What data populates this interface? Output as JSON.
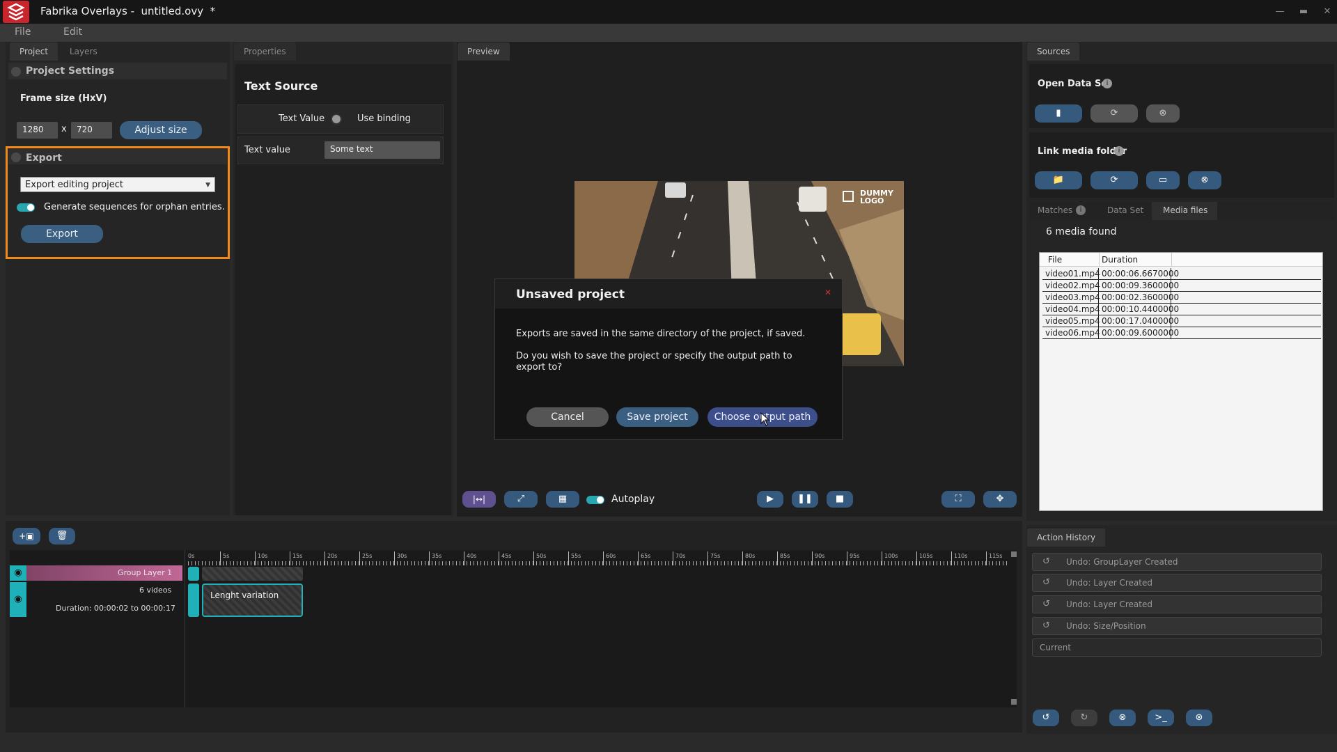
{
  "window": {
    "app_name": "Fabrika Overlays -  untitled.ovy  *",
    "minimize_icon": "minimize-icon",
    "maximize_icon": "maximize-icon",
    "close_icon": "close-icon"
  },
  "menu": {
    "file": "File",
    "edit": "Edit"
  },
  "left_panel": {
    "tabs": [
      "Project",
      "Layers"
    ],
    "project_settings": "Project Settings",
    "frame_size_label": "Frame size (HxV)",
    "width": "1280",
    "height": "720",
    "x_sep": "x",
    "adjust_size": "Adjust size",
    "export_section": "Export",
    "export_mode": "Export editing project",
    "orphan_label": "Generate sequences for orphan entries.",
    "export_button": "Export"
  },
  "properties_panel": {
    "tab": "Properties",
    "title": "Text Source",
    "text_value_label": "Text Value",
    "use_binding": "Use binding",
    "text_value_row_label": "Text value",
    "text_value": "Some text"
  },
  "preview_panel": {
    "tab": "Preview",
    "logo_text_1": "DUMMY",
    "logo_text_2": "LOGO",
    "autoplay": "Autoplay"
  },
  "sources_panel": {
    "tab": "Sources",
    "open_data_set": "Open Data Set",
    "link_media_folder": "Link media folder",
    "subtabs": [
      "Matches",
      "Data Set",
      "Media files"
    ],
    "media_found": "6 media found",
    "table": {
      "headers": [
        "File",
        "Duration"
      ],
      "rows": [
        [
          "video01.mp4",
          "00:00:06.6670000"
        ],
        [
          "video02.mp4",
          "00:00:09.3600000"
        ],
        [
          "video03.mp4",
          "00:00:02.3600000"
        ],
        [
          "video04.mp4",
          "00:00:10.4400000"
        ],
        [
          "video05.mp4",
          "00:00:17.0400000"
        ],
        [
          "video06.mp4",
          "00:00:09.6000000"
        ]
      ]
    }
  },
  "history_panel": {
    "tab": "Action History",
    "items": [
      "Undo: GroupLayer Created",
      "Undo: Layer Created",
      "Undo: Layer Created",
      "Undo: Size/Position"
    ],
    "current": "Current"
  },
  "timeline": {
    "ticks": [
      "0s",
      "5s",
      "10s",
      "15s",
      "20s",
      "25s",
      "30s",
      "35s",
      "40s",
      "45s",
      "50s",
      "55s",
      "60s",
      "65s",
      "70s",
      "75s",
      "80s",
      "85s",
      "90s",
      "95s",
      "100s",
      "105s",
      "110s",
      "115s"
    ],
    "group_layer": "Group Layer 1",
    "videos_count": "6 videos",
    "duration": "Duration: 00:00:02 to 00:00:17",
    "clip_label": "Lenght variation"
  },
  "dialog": {
    "title": "Unsaved project",
    "close_icon": "close-icon",
    "line1": "Exports are saved in the same directory of the project, if saved.",
    "line2": "Do you wish to save the project or specify the output path to export to?",
    "cancel": "Cancel",
    "save_project": "Save project",
    "choose_output": "Choose output path"
  },
  "colors": {
    "accent_teal": "#2aa6b0",
    "highlight_orange": "#f08a1c",
    "button_blue": "#3a5f80",
    "brand_red": "#c8262c"
  }
}
